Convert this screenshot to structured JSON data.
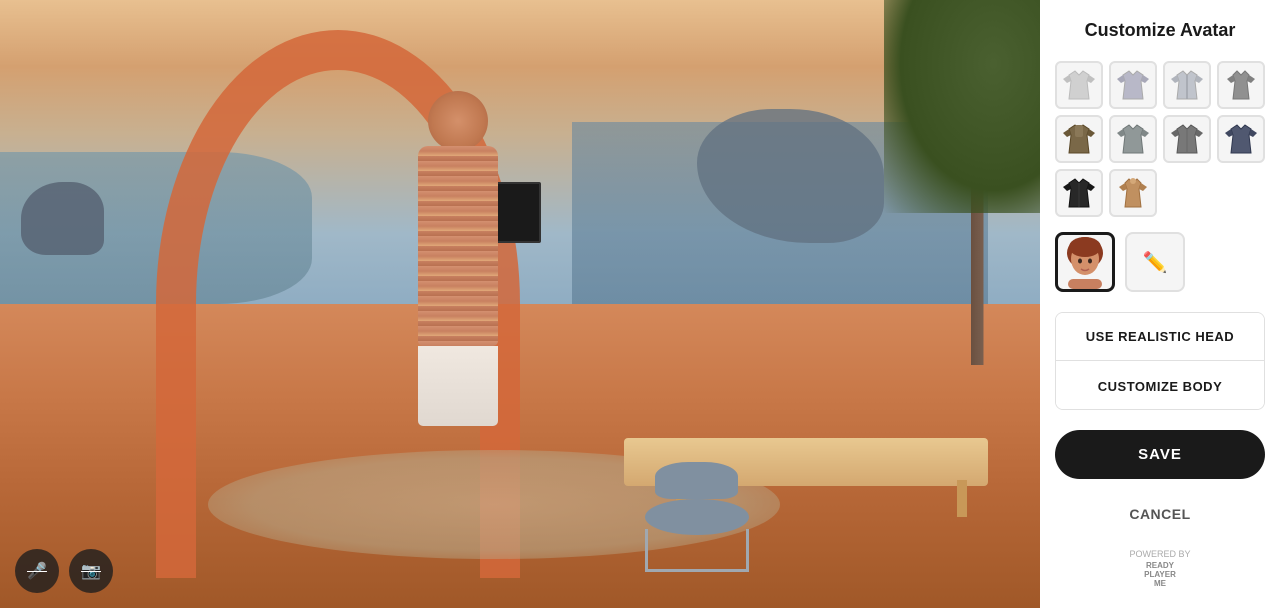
{
  "panel": {
    "title": "Customize Avatar",
    "outfits": [
      {
        "id": 1,
        "color": "#d8d8d8",
        "type": "tank"
      },
      {
        "id": 2,
        "color": "#b8b8c8",
        "type": "tshirt"
      },
      {
        "id": 3,
        "color": "#c0c4cc",
        "type": "jacket"
      },
      {
        "id": 4,
        "color": "#909090",
        "type": "tanktop"
      },
      {
        "id": 5,
        "color": "#7a6848",
        "type": "hoodie"
      },
      {
        "id": 6,
        "color": "#909898",
        "type": "vest"
      },
      {
        "id": 7,
        "color": "#787878",
        "type": "cardigan"
      },
      {
        "id": 8,
        "color": "#505870",
        "type": "coat"
      },
      {
        "id": 9,
        "color": "#282828",
        "type": "jacket-dark"
      },
      {
        "id": 10,
        "color": "#c09060",
        "type": "tanktop2"
      },
      {
        "id": 11,
        "color": "#888",
        "type": "empty"
      },
      {
        "id": 12,
        "color": "#888",
        "type": "empty"
      }
    ],
    "head_options": [
      {
        "id": "avatar",
        "label": "Avatar head",
        "selected": true
      },
      {
        "id": "edit",
        "label": "Edit head"
      }
    ],
    "buttons": {
      "use_realistic_head": "USE REALISTIC HEAD",
      "customize_body": "CUSTOMIZE BODY",
      "save": "SAVE",
      "cancel": "CANCEL"
    },
    "powered_by": {
      "label": "POWERED BY",
      "brand": "READY\nPLAYER\nME"
    }
  },
  "controls": {
    "mic_mute": "🎤",
    "video_mute": "📷"
  }
}
